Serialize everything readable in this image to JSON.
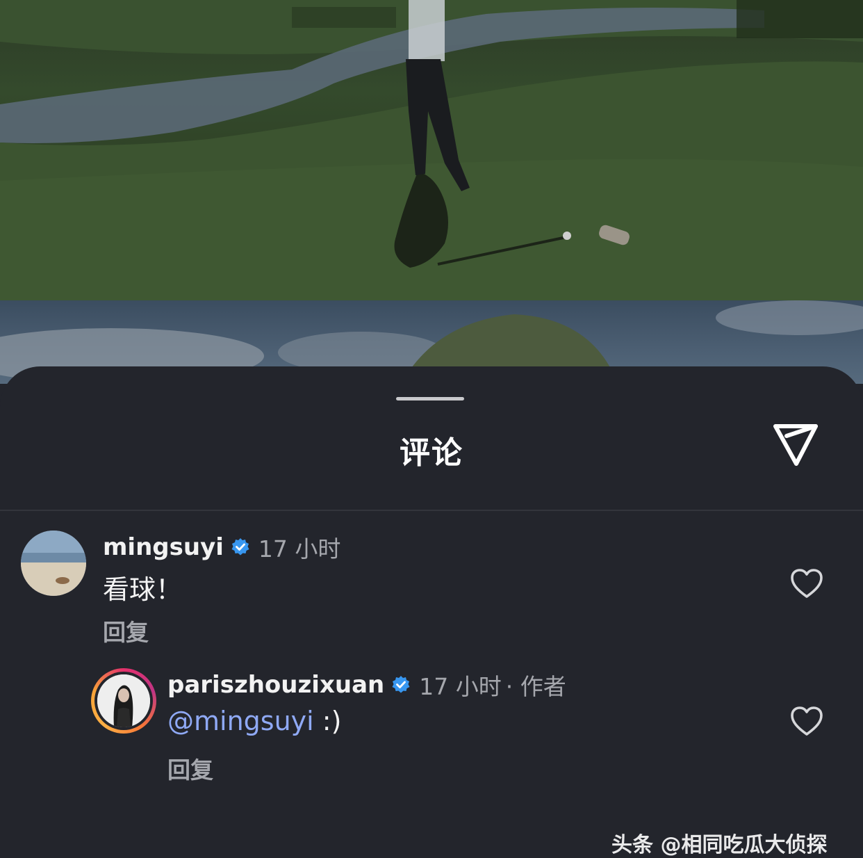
{
  "sheet": {
    "title": "评论",
    "share_icon": "send-icon"
  },
  "comments": [
    {
      "username": "mingsuyi",
      "verified": true,
      "time": "17 小时",
      "text": "看球！",
      "reply_label": "回复",
      "like_icon": "heart-icon"
    },
    {
      "username": "pariszhouzixuan",
      "verified": true,
      "time": "17 小时",
      "author_tag": "· 作者",
      "mention": "@mingsuyi",
      "text": " :)",
      "reply_label": "回复",
      "like_icon": "heart-icon"
    }
  ],
  "watermark": "头条 @相同吃瓜大侦探",
  "colors": {
    "sheet_bg": "#23252c",
    "verified_blue": "#3897f0",
    "mention": "#8fa9f5",
    "muted_text": "#a5a7ad"
  }
}
